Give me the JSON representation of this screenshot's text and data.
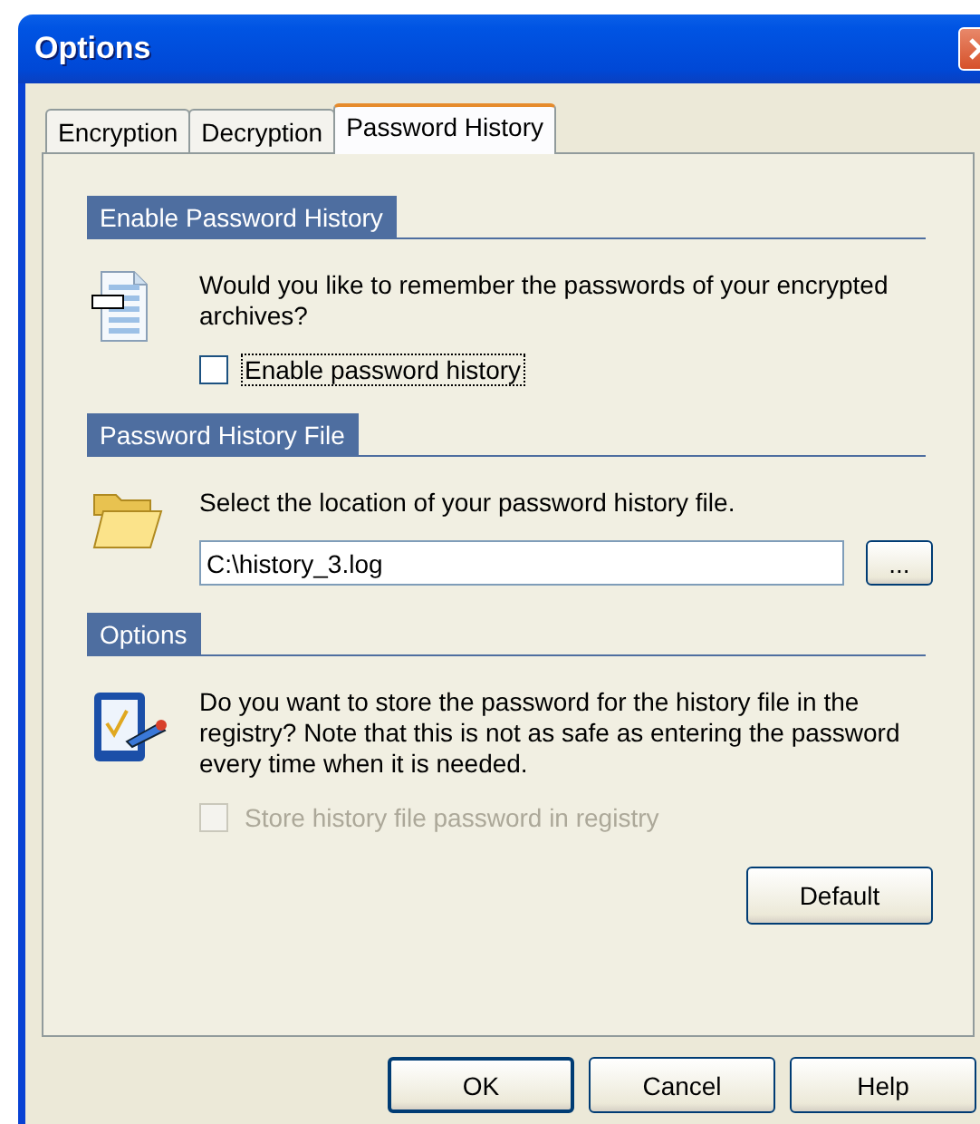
{
  "window": {
    "title": "Options"
  },
  "tabs": [
    {
      "label": "Encryption",
      "selected": false
    },
    {
      "label": "Decryption",
      "selected": false
    },
    {
      "label": "Password History",
      "selected": true
    }
  ],
  "sections": [
    {
      "title": "Enable Password History",
      "text": "Would you like to remember the passwords of your encrypted archives?",
      "checkbox": {
        "label": "Enable password history",
        "checked": false,
        "disabled": false,
        "focused": true
      }
    },
    {
      "title": "Password History File",
      "text": "Select the location of your password history file.",
      "field": {
        "value": "C:\\history_3.log"
      },
      "browse_button": "..."
    },
    {
      "title": "Options",
      "text": "Do you want to store the password for the history file in the registry? Note that this is not as safe as entering the password every time when it is needed.",
      "checkbox": {
        "label": "Store history file password in registry",
        "checked": false,
        "disabled": true,
        "focused": false
      },
      "button": "Default"
    }
  ],
  "buttons": [
    {
      "label": "OK",
      "default": true
    },
    {
      "label": "Cancel",
      "default": false
    },
    {
      "label": "Help",
      "default": false
    }
  ]
}
